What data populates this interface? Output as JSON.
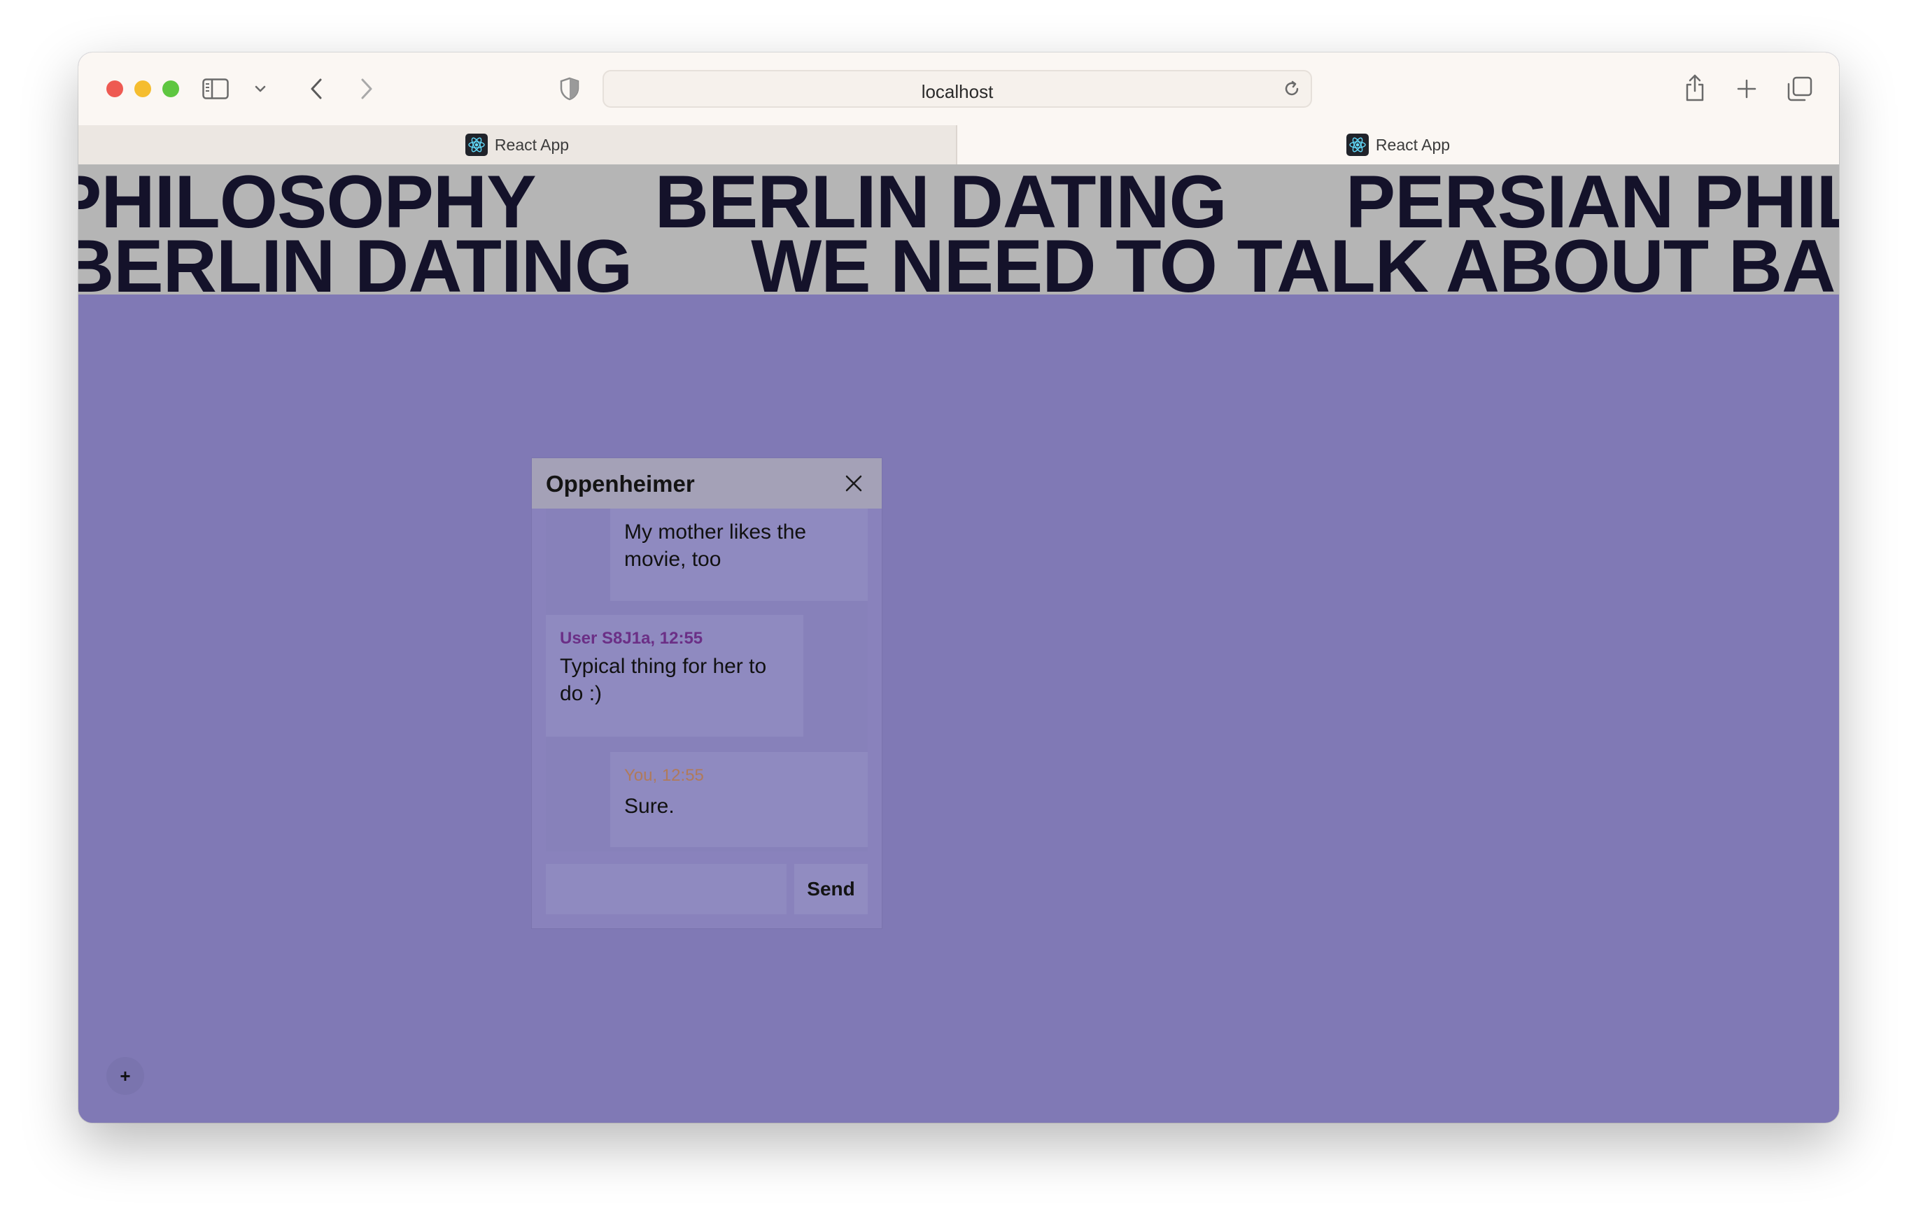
{
  "browser": {
    "address": "localhost",
    "tabs": [
      {
        "label": "React App",
        "active": false
      },
      {
        "label": "React App",
        "active": true
      }
    ]
  },
  "marquee": {
    "line1": [
      "PHILOSOPHY",
      "BERLIN DATING",
      "PERSIAN PHILOSOPHY"
    ],
    "line2": [
      "BERLIN DATING",
      "WE NEED TO TALK ABOUT BARBIE"
    ]
  },
  "chat": {
    "title": "Oppenheimer",
    "messages": [
      {
        "meta": "",
        "text": "My mother likes the movie, too",
        "own": true
      },
      {
        "meta": "User S8J1a, 12:55",
        "text": "Typical thing for her to do :)",
        "own": false
      },
      {
        "meta": "You, 12:55",
        "text": "Sure.",
        "own": true
      }
    ],
    "input_value": "",
    "send_label": "Send"
  },
  "fab_label": "+",
  "colors": {
    "page_bg": "#8079b5",
    "marquee_bg": "#b5b5b5",
    "marquee_text": "#14122a",
    "chat_header_bg": "#a4a1b7",
    "user_meta": "#6b2f86",
    "own_meta": "#b07a5a"
  }
}
